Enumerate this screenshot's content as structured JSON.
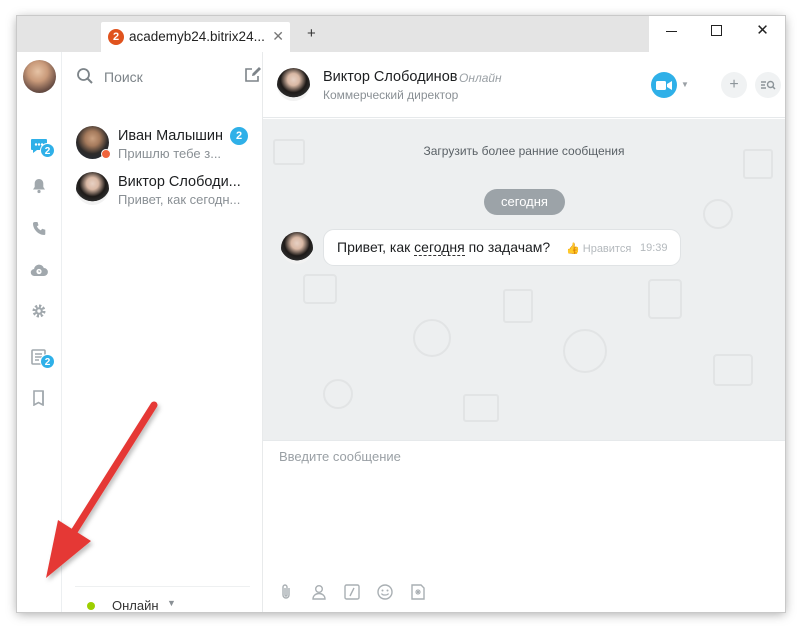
{
  "titlebar": {
    "tab_badge": "2",
    "tab_title": "academyb24.bitrix24...",
    "tab_close": "✕",
    "new_tab": "+",
    "close_glyph": "✕"
  },
  "leftnav": {
    "chat_badge": "2",
    "tasks_badge": "2"
  },
  "chatlist": {
    "search_placeholder": "Поиск",
    "items": [
      {
        "name": "Иван Малышин",
        "preview": "Пришлю тебе з...",
        "count": "2"
      },
      {
        "name": "Виктор Слободи...",
        "preview": "Привет, как сегодн..."
      }
    ],
    "status_label": "Онлайн",
    "status_caret": "▼"
  },
  "dialog": {
    "header": {
      "name": "Виктор Слободинов",
      "status": "Онлайн",
      "position": "Коммерческий директор",
      "caret": "▼",
      "add": "+"
    },
    "load_earlier": "Загрузить более ранние сообщения",
    "date_pill": "сегодня",
    "message": {
      "text_before": "Привет, как ",
      "text_link": "сегодня",
      "text_after": " по задачам?",
      "like": "👍 Нравится",
      "time": "19:39"
    },
    "input_placeholder": "Введите сообщение"
  },
  "colors": {
    "accent": "#2fb0e8",
    "tab_badge": "#e0531e",
    "online": "#9dcf00",
    "arrow": "#e53935"
  }
}
